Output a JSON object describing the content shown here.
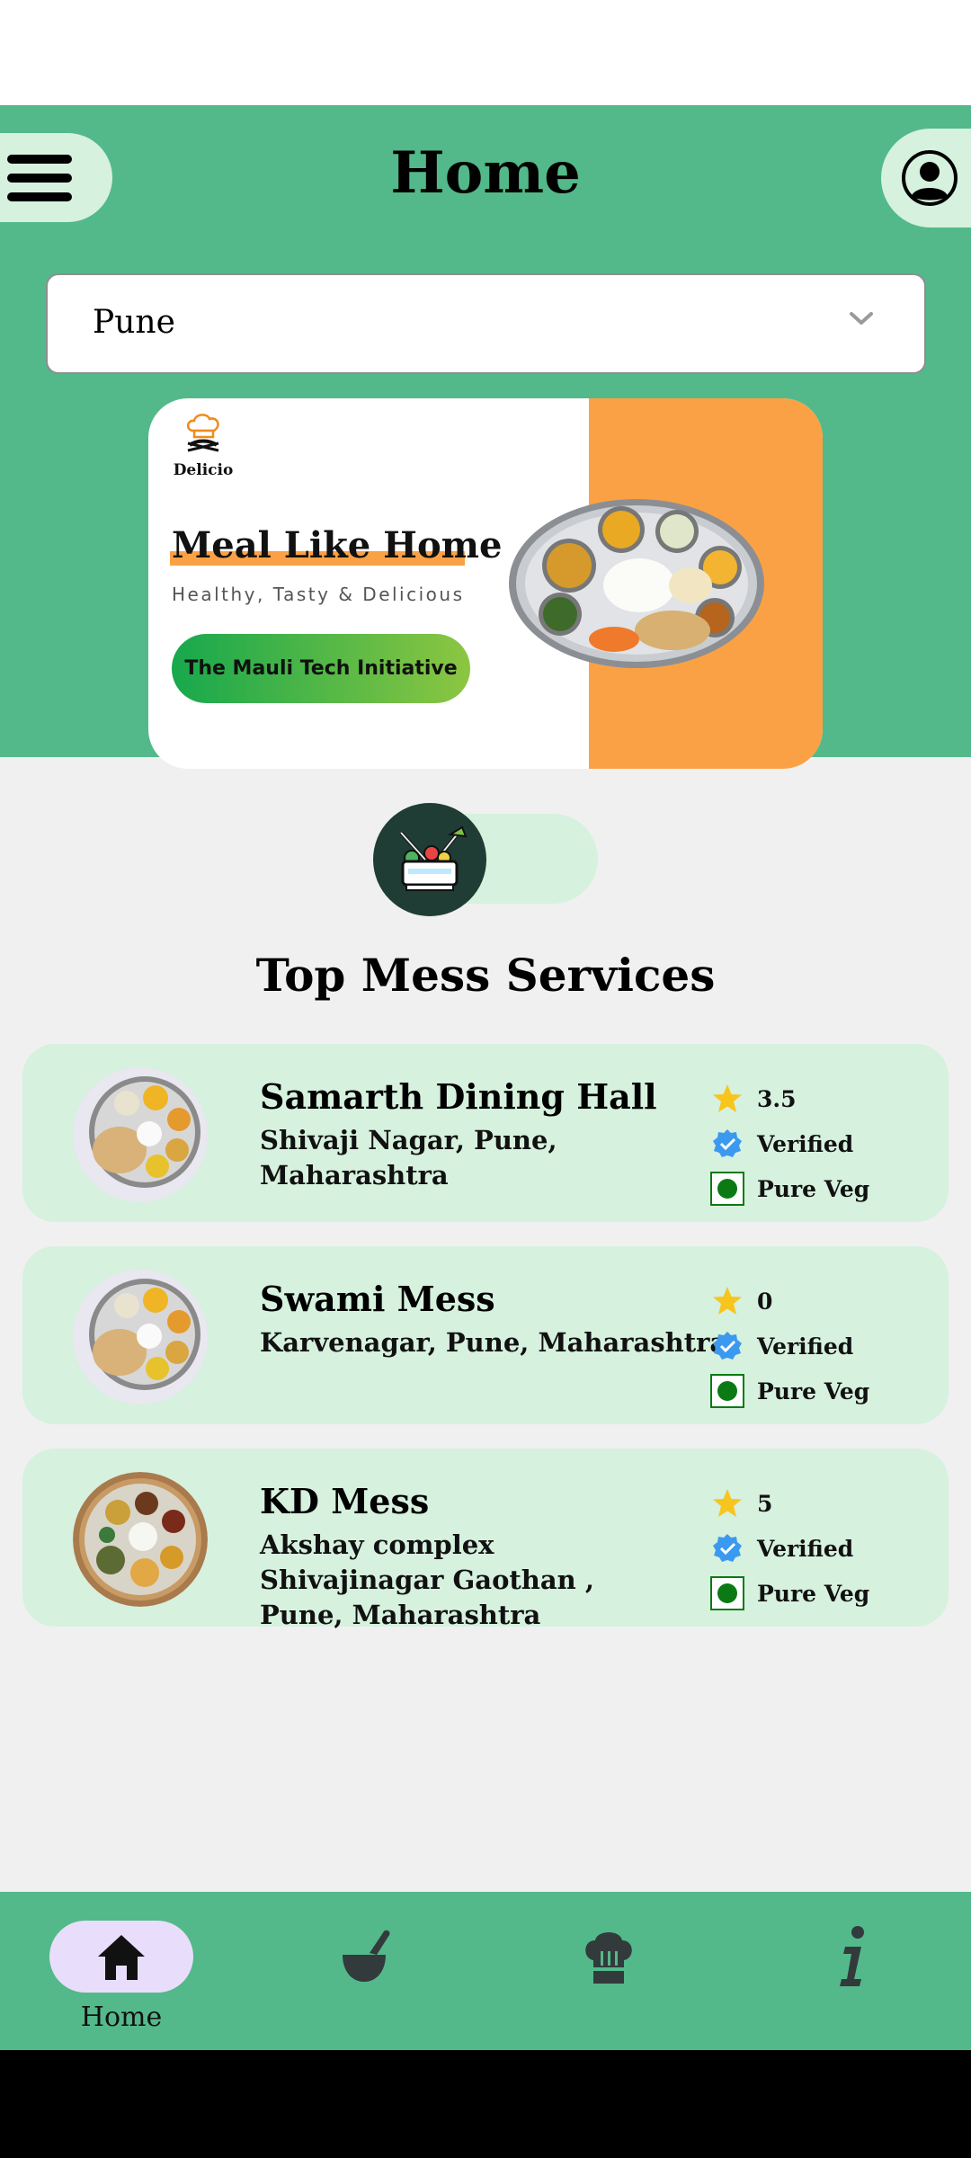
{
  "header": {
    "title": "Home",
    "menu_icon": "hamburger-menu-icon",
    "profile_icon": "account-circle-icon"
  },
  "city_select": {
    "value": "Pune",
    "icon": "chevron-down-icon"
  },
  "banner": {
    "brand": "Delicio",
    "tagline": "Meal Like Home",
    "subtagline": "Healthy, Tasty & Delicious",
    "cta": "The Mauli Tech Initiative"
  },
  "section": {
    "title": "Top Mess Services"
  },
  "mess_list": [
    {
      "name": "Samarth Dining Hall",
      "address": "Shivaji Nagar, Pune, Maharashtra",
      "rating": "3.5",
      "verified": "Verified",
      "diet": "Pure Veg"
    },
    {
      "name": "Swami Mess",
      "address": "Karvenagar, Pune, Maharashtra",
      "rating": "0",
      "verified": "Verified",
      "diet": "Pure Veg"
    },
    {
      "name": "KD Mess",
      "address": "Akshay complex Shivajinagar Gaothan , Pune, Maharashtra",
      "rating": "5",
      "verified": "Verified",
      "diet": "Pure Veg"
    }
  ],
  "bottom_nav": [
    {
      "label": "Home",
      "icon": "home-icon",
      "active": true
    },
    {
      "label": "",
      "icon": "mortar-pestle-icon",
      "active": false
    },
    {
      "label": "",
      "icon": "chef-hat-icon",
      "active": false
    },
    {
      "label": "",
      "icon": "info-icon",
      "active": false
    }
  ],
  "colors": {
    "primary_green": "#53b98a",
    "light_green": "#d6f1de",
    "accent_orange": "#fba145",
    "nav_active": "#e8defb",
    "star": "#f7c51e",
    "verified": "#3b9af0",
    "veg_dot": "#0b7a14"
  }
}
